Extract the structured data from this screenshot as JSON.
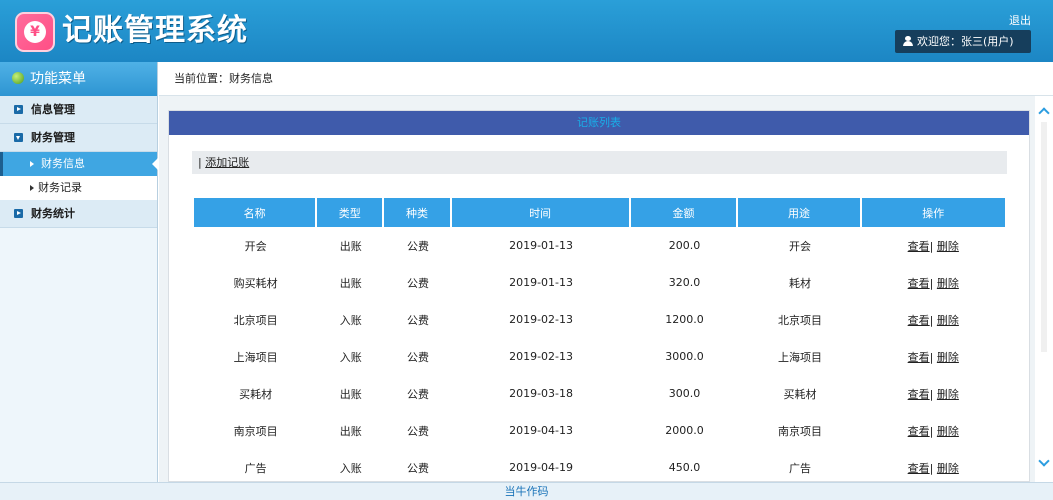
{
  "header": {
    "logo_glyph": "¥",
    "title": "记账管理系统",
    "logout_label": "退出",
    "welcome_text": "欢迎您：张三(用户)"
  },
  "sidebar": {
    "title": "功能菜单",
    "groups": [
      {
        "label": "信息管理",
        "icon": "expand-right-icon"
      },
      {
        "label": "财务管理",
        "icon": "collapse-down-icon",
        "items": [
          {
            "label": "财务信息",
            "active": true
          },
          {
            "label": "财务记录",
            "active": false
          }
        ]
      },
      {
        "label": "财务统计",
        "icon": "expand-right-icon"
      }
    ]
  },
  "breadcrumb": "当前位置：财务信息",
  "panel": {
    "title": "记账列表",
    "toolbar_prefix": "| ",
    "add_label": "添加记账"
  },
  "table": {
    "headers": [
      "名称",
      "类型",
      "种类",
      "时间",
      "金额",
      "用途",
      "操作"
    ],
    "rows": [
      {
        "name": "开会",
        "type": "出账",
        "kind": "公费",
        "date": "2019-01-13",
        "amount": "200.0",
        "use": "开会"
      },
      {
        "name": "购买耗材",
        "type": "出账",
        "kind": "公费",
        "date": "2019-01-13",
        "amount": "320.0",
        "use": "耗材"
      },
      {
        "name": "北京项目",
        "type": "入账",
        "kind": "公费",
        "date": "2019-02-13",
        "amount": "1200.0",
        "use": "北京项目"
      },
      {
        "name": "上海项目",
        "type": "入账",
        "kind": "公费",
        "date": "2019-02-13",
        "amount": "3000.0",
        "use": "上海项目"
      },
      {
        "name": "买耗材",
        "type": "出账",
        "kind": "公费",
        "date": "2019-03-18",
        "amount": "300.0",
        "use": "买耗材"
      },
      {
        "name": "南京项目",
        "type": "出账",
        "kind": "公费",
        "date": "2019-04-13",
        "amount": "2000.0",
        "use": "南京项目"
      },
      {
        "name": "广告",
        "type": "入账",
        "kind": "公费",
        "date": "2019-04-19",
        "amount": "450.0",
        "use": "广告"
      }
    ],
    "view_label": "查看",
    "separator": "|",
    "delete_label": "删除"
  },
  "footer": "当牛作码",
  "colors": {
    "header_bg": "#1c86c4",
    "panel_head_bg": "#3f5bab",
    "table_head_bg": "#35a1e6",
    "active_menu_bg": "#3fa6e2"
  }
}
